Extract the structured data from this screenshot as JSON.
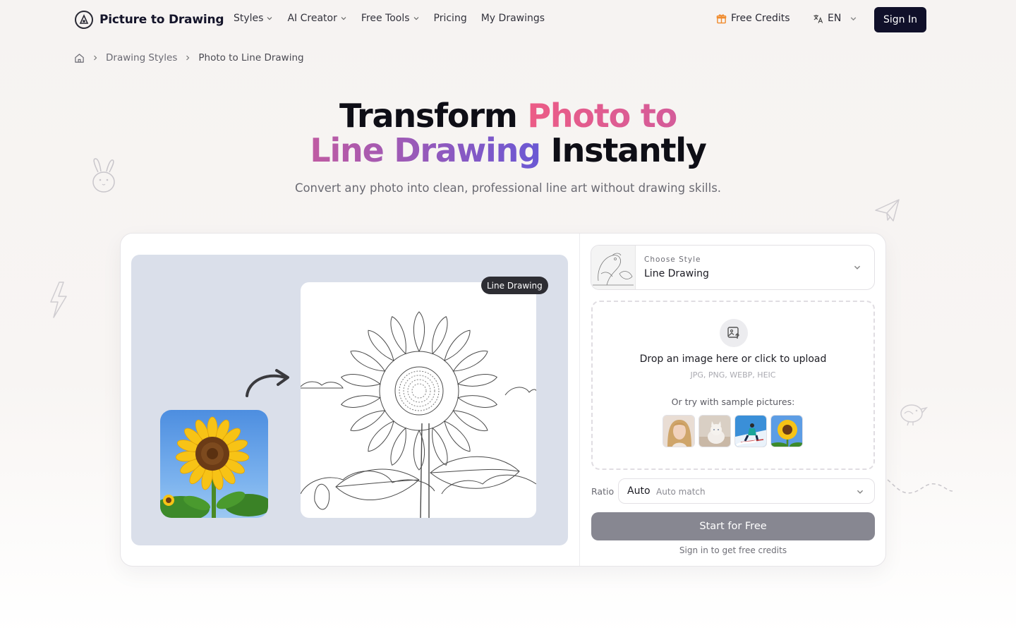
{
  "header": {
    "logo_text": "Picture to Drawing",
    "nav": [
      {
        "label": "Styles",
        "has_dropdown": true
      },
      {
        "label": "AI Creator",
        "has_dropdown": true
      },
      {
        "label": "Free Tools",
        "has_dropdown": true
      },
      {
        "label": "Pricing",
        "has_dropdown": false
      },
      {
        "label": "My Drawings",
        "has_dropdown": false
      }
    ],
    "credits_label": "Free Credits",
    "language": "EN",
    "sign_in_label": "Sign In"
  },
  "breadcrumb": {
    "items": [
      "Drawing Styles",
      "Photo to Line Drawing"
    ]
  },
  "hero": {
    "title_part1": "Transform ",
    "title_highlight1": "Photo to",
    "title_highlight2": "Line Drawing",
    "title_part2": " Instantly",
    "subtitle": "Convert any photo into clean, professional line art without drawing skills."
  },
  "preview": {
    "tag": "Line Drawing"
  },
  "style_select": {
    "caption": "Choose Style",
    "value": "Line Drawing"
  },
  "upload": {
    "title": "Drop an image here or click to upload",
    "formats": "JPG, PNG, WEBP, HEIC",
    "samples_label": "Or try with sample pictures:",
    "samples": [
      "portrait-woman",
      "cat",
      "skier",
      "sunflower"
    ]
  },
  "ratio": {
    "label": "Ratio",
    "value": "Auto",
    "sub": "Auto match"
  },
  "start_button": "Start for Free",
  "signin_note": "Sign in to get free credits",
  "colors": {
    "brand_dark": "#10102a",
    "gradient_pink": "#ec5c86",
    "gradient_purple": "#6a58d4",
    "start_button": "#878791",
    "gift_icon": "#f08a2c"
  }
}
